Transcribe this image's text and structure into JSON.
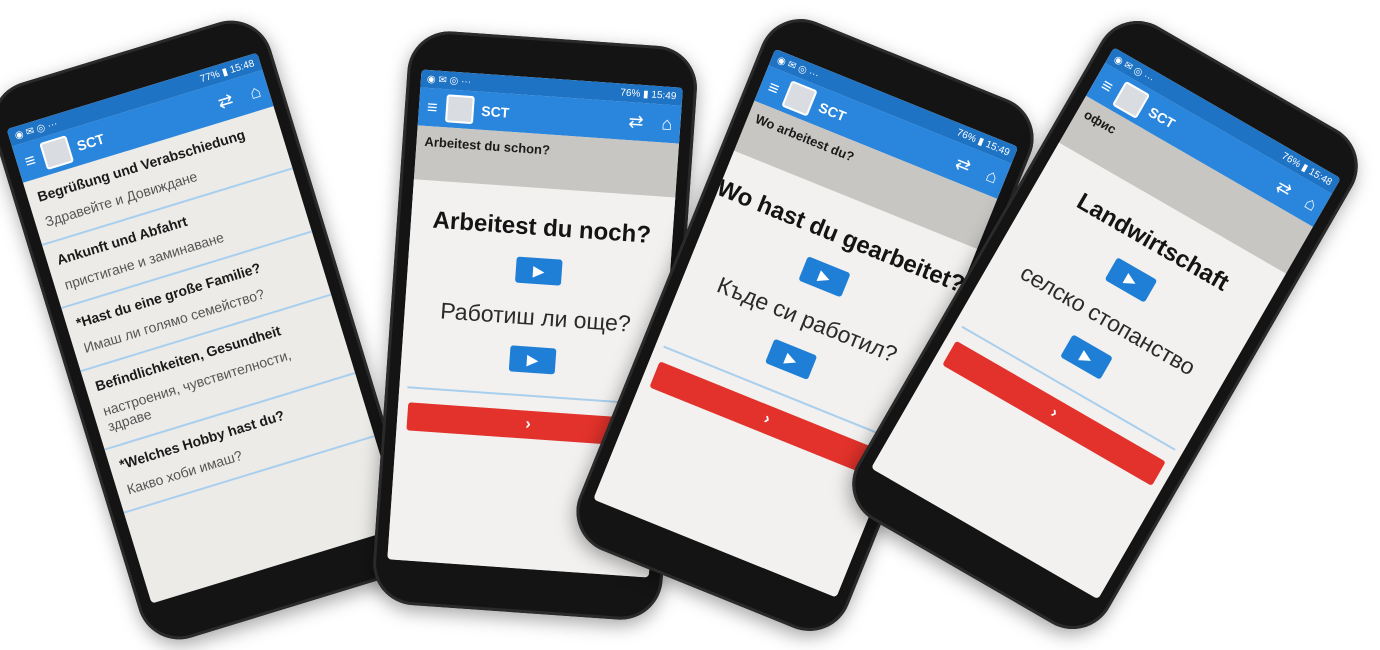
{
  "phones": [
    {
      "status": {
        "left_icons": "◉ ✉ ◎ ···",
        "right": "77% ▮ 15:48"
      },
      "app": {
        "title": "SCT",
        "menu_icon": "≡",
        "swap_icon": "⇄",
        "home_icon": "⌂"
      },
      "list": [
        {
          "de": "Begrüßung und Verabschiedung",
          "bg": "Здравейте и Довиждане"
        },
        {
          "de": "Ankunft und Abfahrt",
          "bg": "пристигане и заминаване"
        },
        {
          "de": "*Hast du eine große Familie?",
          "bg": "Имаш ли голямо семейство?"
        },
        {
          "de": "Befindlichkeiten, Gesundheit",
          "bg": "настроения, чувствителности, здраве"
        },
        {
          "de": "*Welches Hobby hast du?",
          "bg": "Какво хоби имаш?"
        }
      ]
    },
    {
      "status": {
        "left_icons": "◉ ✉ ◎ ···",
        "right": "76% ▮ 15:49"
      },
      "app": {
        "title": "SCT",
        "menu_icon": "≡",
        "swap_icon": "⇄",
        "home_icon": "⌂"
      },
      "header": "Arbeitest du schon?",
      "card": {
        "de": "Arbeitest du noch?",
        "bg": "Работиш ли още?",
        "play": "▶",
        "next": "›"
      }
    },
    {
      "status": {
        "left_icons": "◉ ✉ ◎ ···",
        "right": "76% ▮ 15:49"
      },
      "app": {
        "title": "SCT",
        "menu_icon": "≡",
        "swap_icon": "⇄",
        "home_icon": "⌂"
      },
      "header": "Wo arbeitest du?",
      "card": {
        "de": "Wo hast du gearbeitet?",
        "bg": "Къде си работил?",
        "play": "▶",
        "next": "›"
      }
    },
    {
      "status": {
        "left_icons": "◉ ✉ ◎ ···",
        "right": "76% ▮ 15:48"
      },
      "app": {
        "title": "SCT",
        "menu_icon": "≡",
        "swap_icon": "⇄",
        "home_icon": "⌂"
      },
      "header": "офис",
      "card": {
        "de": "Landwirtschaft",
        "bg": "селско стопанство",
        "play": "▶",
        "next": "›"
      }
    }
  ]
}
